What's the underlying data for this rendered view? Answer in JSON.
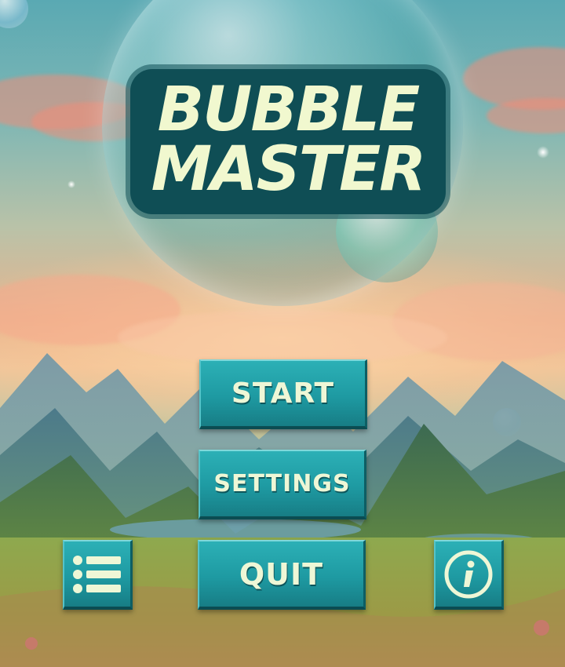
{
  "game": {
    "title_line1": "BUBBLE",
    "title_line2": "MASTER"
  },
  "menu": {
    "start_label": "START",
    "settings_label": "SETTINGS",
    "quit_label": "QUIT"
  },
  "corner_buttons": {
    "left_icon": "list-icon",
    "right_icon": "info-icon"
  },
  "colors": {
    "button_teal": "#1e9aa2",
    "title_text": "#f1f8cf",
    "title_outline": "#0f4e55"
  }
}
